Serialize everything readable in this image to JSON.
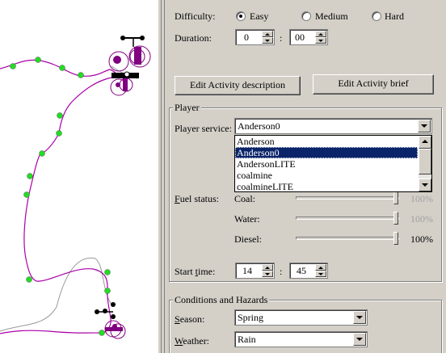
{
  "difficulty": {
    "label": "Difficulty:",
    "options": [
      {
        "label": "Easy",
        "selected": true
      },
      {
        "label": "Medium",
        "selected": false
      },
      {
        "label": "Hard",
        "selected": false
      }
    ]
  },
  "duration": {
    "label": "Duration:",
    "hours": "0",
    "minutes": "00",
    "sep": ":"
  },
  "buttons": {
    "edit_description": "Edit Activity description",
    "edit_brief": "Edit Activity brief"
  },
  "player": {
    "group_title": "Player",
    "service_label": "Player service:",
    "service_value": "Anderson0",
    "service_options": [
      "Anderson",
      "Anderson0",
      "AndersonLITE",
      "coalmine",
      "coalmineLITE"
    ],
    "service_selected_index": 1,
    "fuel_label": "Fuel status:",
    "fuel": [
      {
        "label": "Coal:",
        "value": "100%",
        "level": 1.0,
        "enabled": false
      },
      {
        "label": "Water:",
        "value": "100%",
        "level": 1.0,
        "enabled": false
      },
      {
        "label": "Diesel:",
        "value": "100%",
        "level": 1.0,
        "enabled": true
      }
    ],
    "start_time_label": "Start time:",
    "start_hours": "14",
    "start_minutes": "45",
    "sep": ":"
  },
  "conditions": {
    "group_title": "Conditions and Hazards",
    "season_label": "Season:",
    "season_value": "Spring",
    "weather_label": "Weather:",
    "weather_value": "Rain"
  },
  "colors": {
    "panel_bg": "#d4d0c8",
    "selection": "#0a246a",
    "track_line": "#aa00aa",
    "track_marker": "#22dd22",
    "marker_highlight": "#800080"
  },
  "map_icons": [
    "waypoint-marker-icon",
    "station-node-icon",
    "signal-cluster-icon"
  ]
}
